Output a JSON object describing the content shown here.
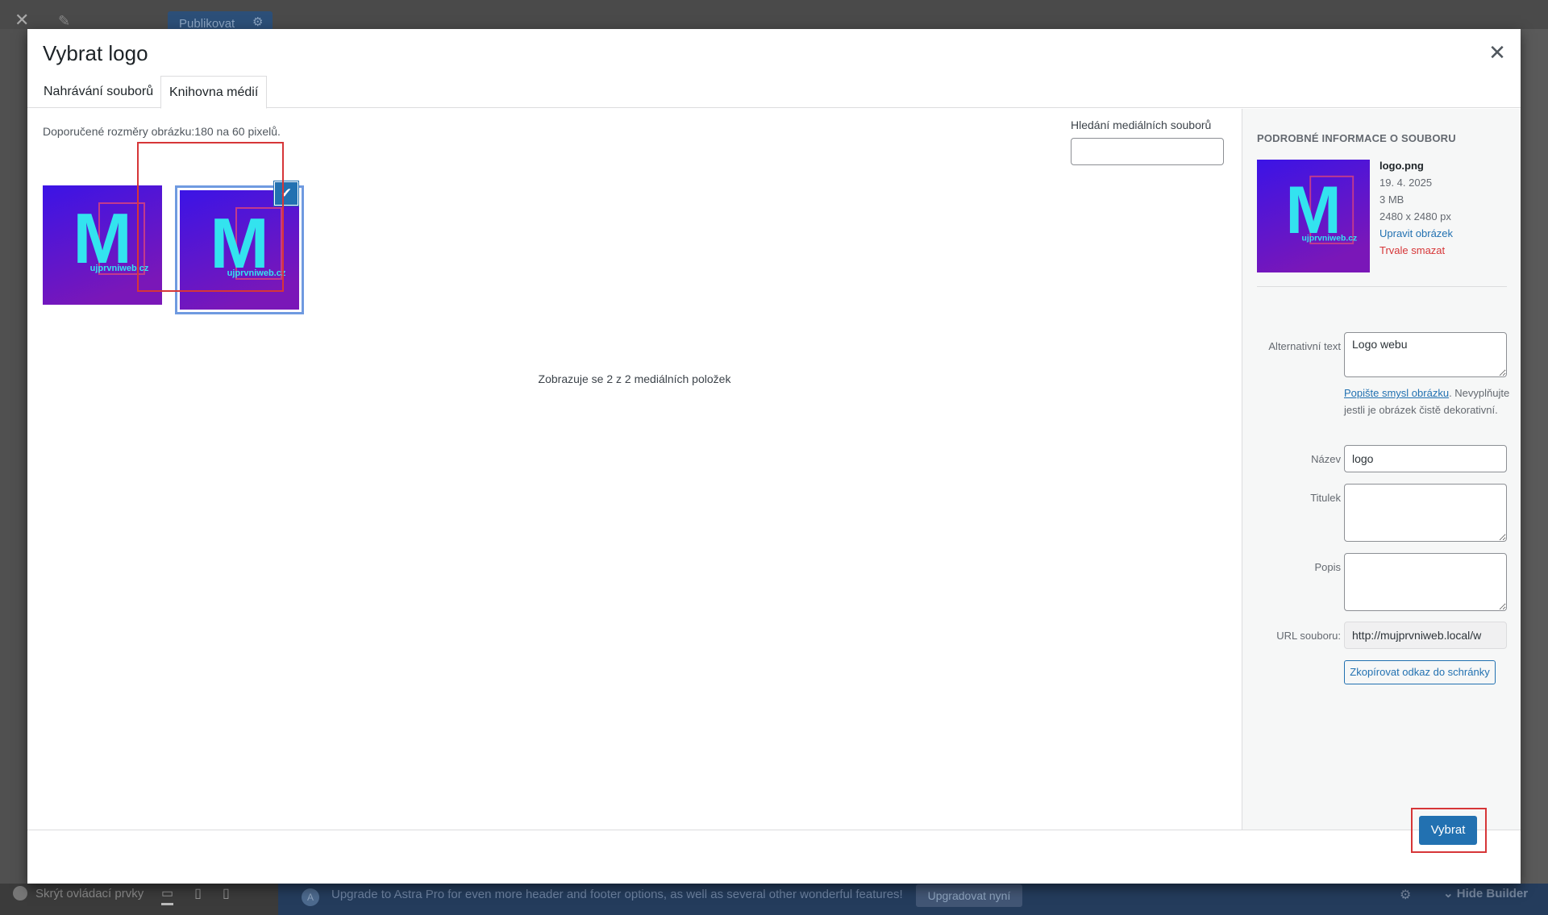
{
  "background": {
    "publish_label": "Publikovat",
    "hide_controls_label": "Skrýt ovládací prvky",
    "upgrade_text": "Upgrade to Astra Pro for even more header and footer options, as well as several other wonderful features!",
    "upgrade_button": "Upgradovat nyní",
    "hide_builder_label": "Hide Builder"
  },
  "modal": {
    "title": "Vybrat logo",
    "close_glyph": "✕",
    "tabs": [
      {
        "label": "Nahrávání souborů",
        "active": false
      },
      {
        "label": "Knihovna médií",
        "active": true
      }
    ],
    "recommended_size": "Doporučené rozměry obrázku:180 na 60 pixelů.",
    "search": {
      "label": "Hledání mediálních souborů",
      "value": ""
    },
    "media_count": "Zobrazuje se 2 z 2 mediálních položek",
    "items": [
      {
        "letter": "M",
        "site": "ujprvniweb.cz",
        "selected": false
      },
      {
        "letter": "M",
        "site": "ujprvniweb.cz",
        "selected": true
      }
    ],
    "check_glyph": "✔"
  },
  "details": {
    "heading": "Podrobné informace o souboru",
    "filename": "logo.png",
    "date": "19. 4. 2025",
    "size": "3 MB",
    "dimensions": "2480 x 2480 px",
    "edit_link": "Upravit obrázek",
    "delete_link": "Trvale smazat",
    "fields": {
      "alt_label": "Alternativní text",
      "alt_value": "Logo webu",
      "alt_help_link": "Popište smysl obrázku",
      "alt_help_rest": "Nevyplňujte jestli je obrázek čistě dekorativní.",
      "title_label": "Název",
      "title_value": "logo",
      "caption_label": "Titulek",
      "caption_value": "",
      "description_label": "Popis",
      "description_value": "",
      "url_label": "URL souboru:",
      "url_value": "http://mujprvniweb.local/w"
    },
    "copy_button": "Zkopírovat odkaz do schránky"
  },
  "toolbar": {
    "select_button": "Vybrat"
  },
  "colors": {
    "accent": "#2271b1",
    "danger": "#d63638",
    "logo_bg_top": "#3b14e6",
    "logo_bg_bottom": "#7a17b8",
    "logo_letter": "#33e3ef"
  }
}
